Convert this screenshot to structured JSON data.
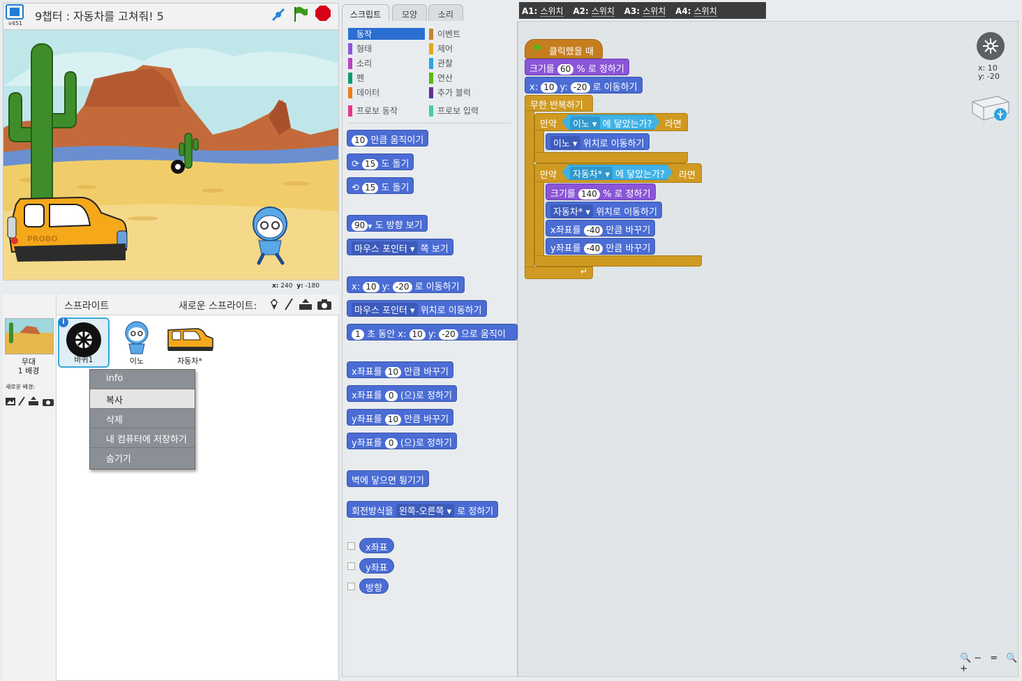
{
  "project": {
    "title": "9챕터 : 자동차를 고쳐줘! 5",
    "version": "v451"
  },
  "stage": {
    "coords_x_label": "x:",
    "coords_x": "240",
    "coords_y_label": "y:",
    "coords_y": "-180",
    "car_text": "PROBO"
  },
  "sprites": {
    "title": "스프라이트",
    "new_label": "새로운 스프라이트:",
    "stage_label": "무대",
    "stage_bg_count": "1 배경",
    "new_bg_label": "새로운 배경:",
    "items": [
      {
        "name": "바퀴1"
      },
      {
        "name": "이노"
      },
      {
        "name": "자동차*"
      }
    ],
    "info_badge": "i"
  },
  "context_menu": {
    "items": [
      "info",
      "복사",
      "삭제",
      "내 컴퓨터에 저장하기",
      "숨기기"
    ]
  },
  "tabs": [
    "스크립트",
    "모양",
    "소리"
  ],
  "categories": {
    "left": [
      {
        "label": "동작",
        "color": "#4a6cd4"
      },
      {
        "label": "형태",
        "color": "#8a55d7"
      },
      {
        "label": "소리",
        "color": "#bb42c3"
      },
      {
        "label": "펜",
        "color": "#0e9a6c"
      },
      {
        "label": "데이터",
        "color": "#ee7d16"
      },
      {
        "label": "프로보 동작",
        "color": "#e6368a"
      }
    ],
    "right": [
      {
        "label": "이벤트",
        "color": "#c88330"
      },
      {
        "label": "제어",
        "color": "#e1a91a"
      },
      {
        "label": "관찰",
        "color": "#2ca5e2"
      },
      {
        "label": "연산",
        "color": "#5cb712"
      },
      {
        "label": "추가 블럭",
        "color": "#632d99"
      },
      {
        "label": "프로보 입력",
        "color": "#4fc9a8"
      }
    ]
  },
  "palette": {
    "move": {
      "value": "10",
      "text": "만큼 움직이기"
    },
    "turn_right": {
      "value": "15",
      "text": "도 돌기"
    },
    "turn_left": {
      "value": "15",
      "text": "도 돌기"
    },
    "point_dir": {
      "value": "90",
      "text": "도 방향 보기"
    },
    "point_towards": {
      "target": "마우스 포인터",
      "text": "쪽 보기"
    },
    "goto_xy": {
      "x_label": "x:",
      "x": "10",
      "y_label": "y:",
      "y": "-20",
      "text": "로 이동하기"
    },
    "goto": {
      "target": "마우스 포인터",
      "text": "위치로 이동하기"
    },
    "glide": {
      "secs": "1",
      "t1": "초 동안 x:",
      "x": "10",
      "y_label": "y:",
      "y": "-20",
      "t2": "으로 움직이"
    },
    "change_x": {
      "pre": "x좌표를",
      "value": "10",
      "post": "만큼 바꾸기"
    },
    "set_x": {
      "pre": "x좌표를",
      "value": "0",
      "post": "(으)로 정하기"
    },
    "change_y": {
      "pre": "y좌표를",
      "value": "10",
      "post": "만큼 바꾸기"
    },
    "set_y": {
      "pre": "y좌표를",
      "value": "0",
      "post": "(으)로 정하기"
    },
    "bounce": "벽에 닿으면 튕기기",
    "rotation": {
      "pre": "회전방식을",
      "value": "왼쪽-오른쪽",
      "post": "로 정하기"
    },
    "reporters": [
      "x좌표",
      "y좌표",
      "방향"
    ]
  },
  "robot_bar": [
    {
      "key": "A1:",
      "value": "스위치"
    },
    {
      "key": "A2:",
      "value": "스위치"
    },
    {
      "key": "A3:",
      "value": "스위치"
    },
    {
      "key": "A4:",
      "value": "스위치"
    }
  ],
  "script": {
    "hat": "클릭했을 때",
    "size1": {
      "pre": "크기를",
      "value": "60",
      "post": "% 로 정하기"
    },
    "goto": {
      "x_label": "x:",
      "x": "10",
      "y_label": "y:",
      "y": "-20",
      "post": "로 이동하기"
    },
    "forever": "무한 반복하기",
    "if1": {
      "pre": "만약",
      "target": "이노",
      "cond": "에 닿았는가?",
      "post": "라면"
    },
    "goto_ino": {
      "target": "이노",
      "post": "위치로 이동하기"
    },
    "if2": {
      "pre": "만약",
      "target": "자동차*",
      "cond": "에 닿았는가?",
      "post": "라면"
    },
    "size2": {
      "pre": "크기를",
      "value": "140",
      "post": "% 로 정하기"
    },
    "goto_car": {
      "target": "자동차*",
      "post": "위치로 이동하기"
    },
    "change_x": {
      "pre": "x좌표를",
      "value": "-40",
      "post": "만큼 바꾸기"
    },
    "change_y": {
      "pre": "y좌표를",
      "value": "-40",
      "post": "만큼 바꾸기"
    },
    "sprite_xy": {
      "x": "x: 10",
      "y": "y: -20"
    }
  },
  "zoom": {
    "out": "🔍−",
    "reset": "=",
    "in": "🔍+"
  }
}
